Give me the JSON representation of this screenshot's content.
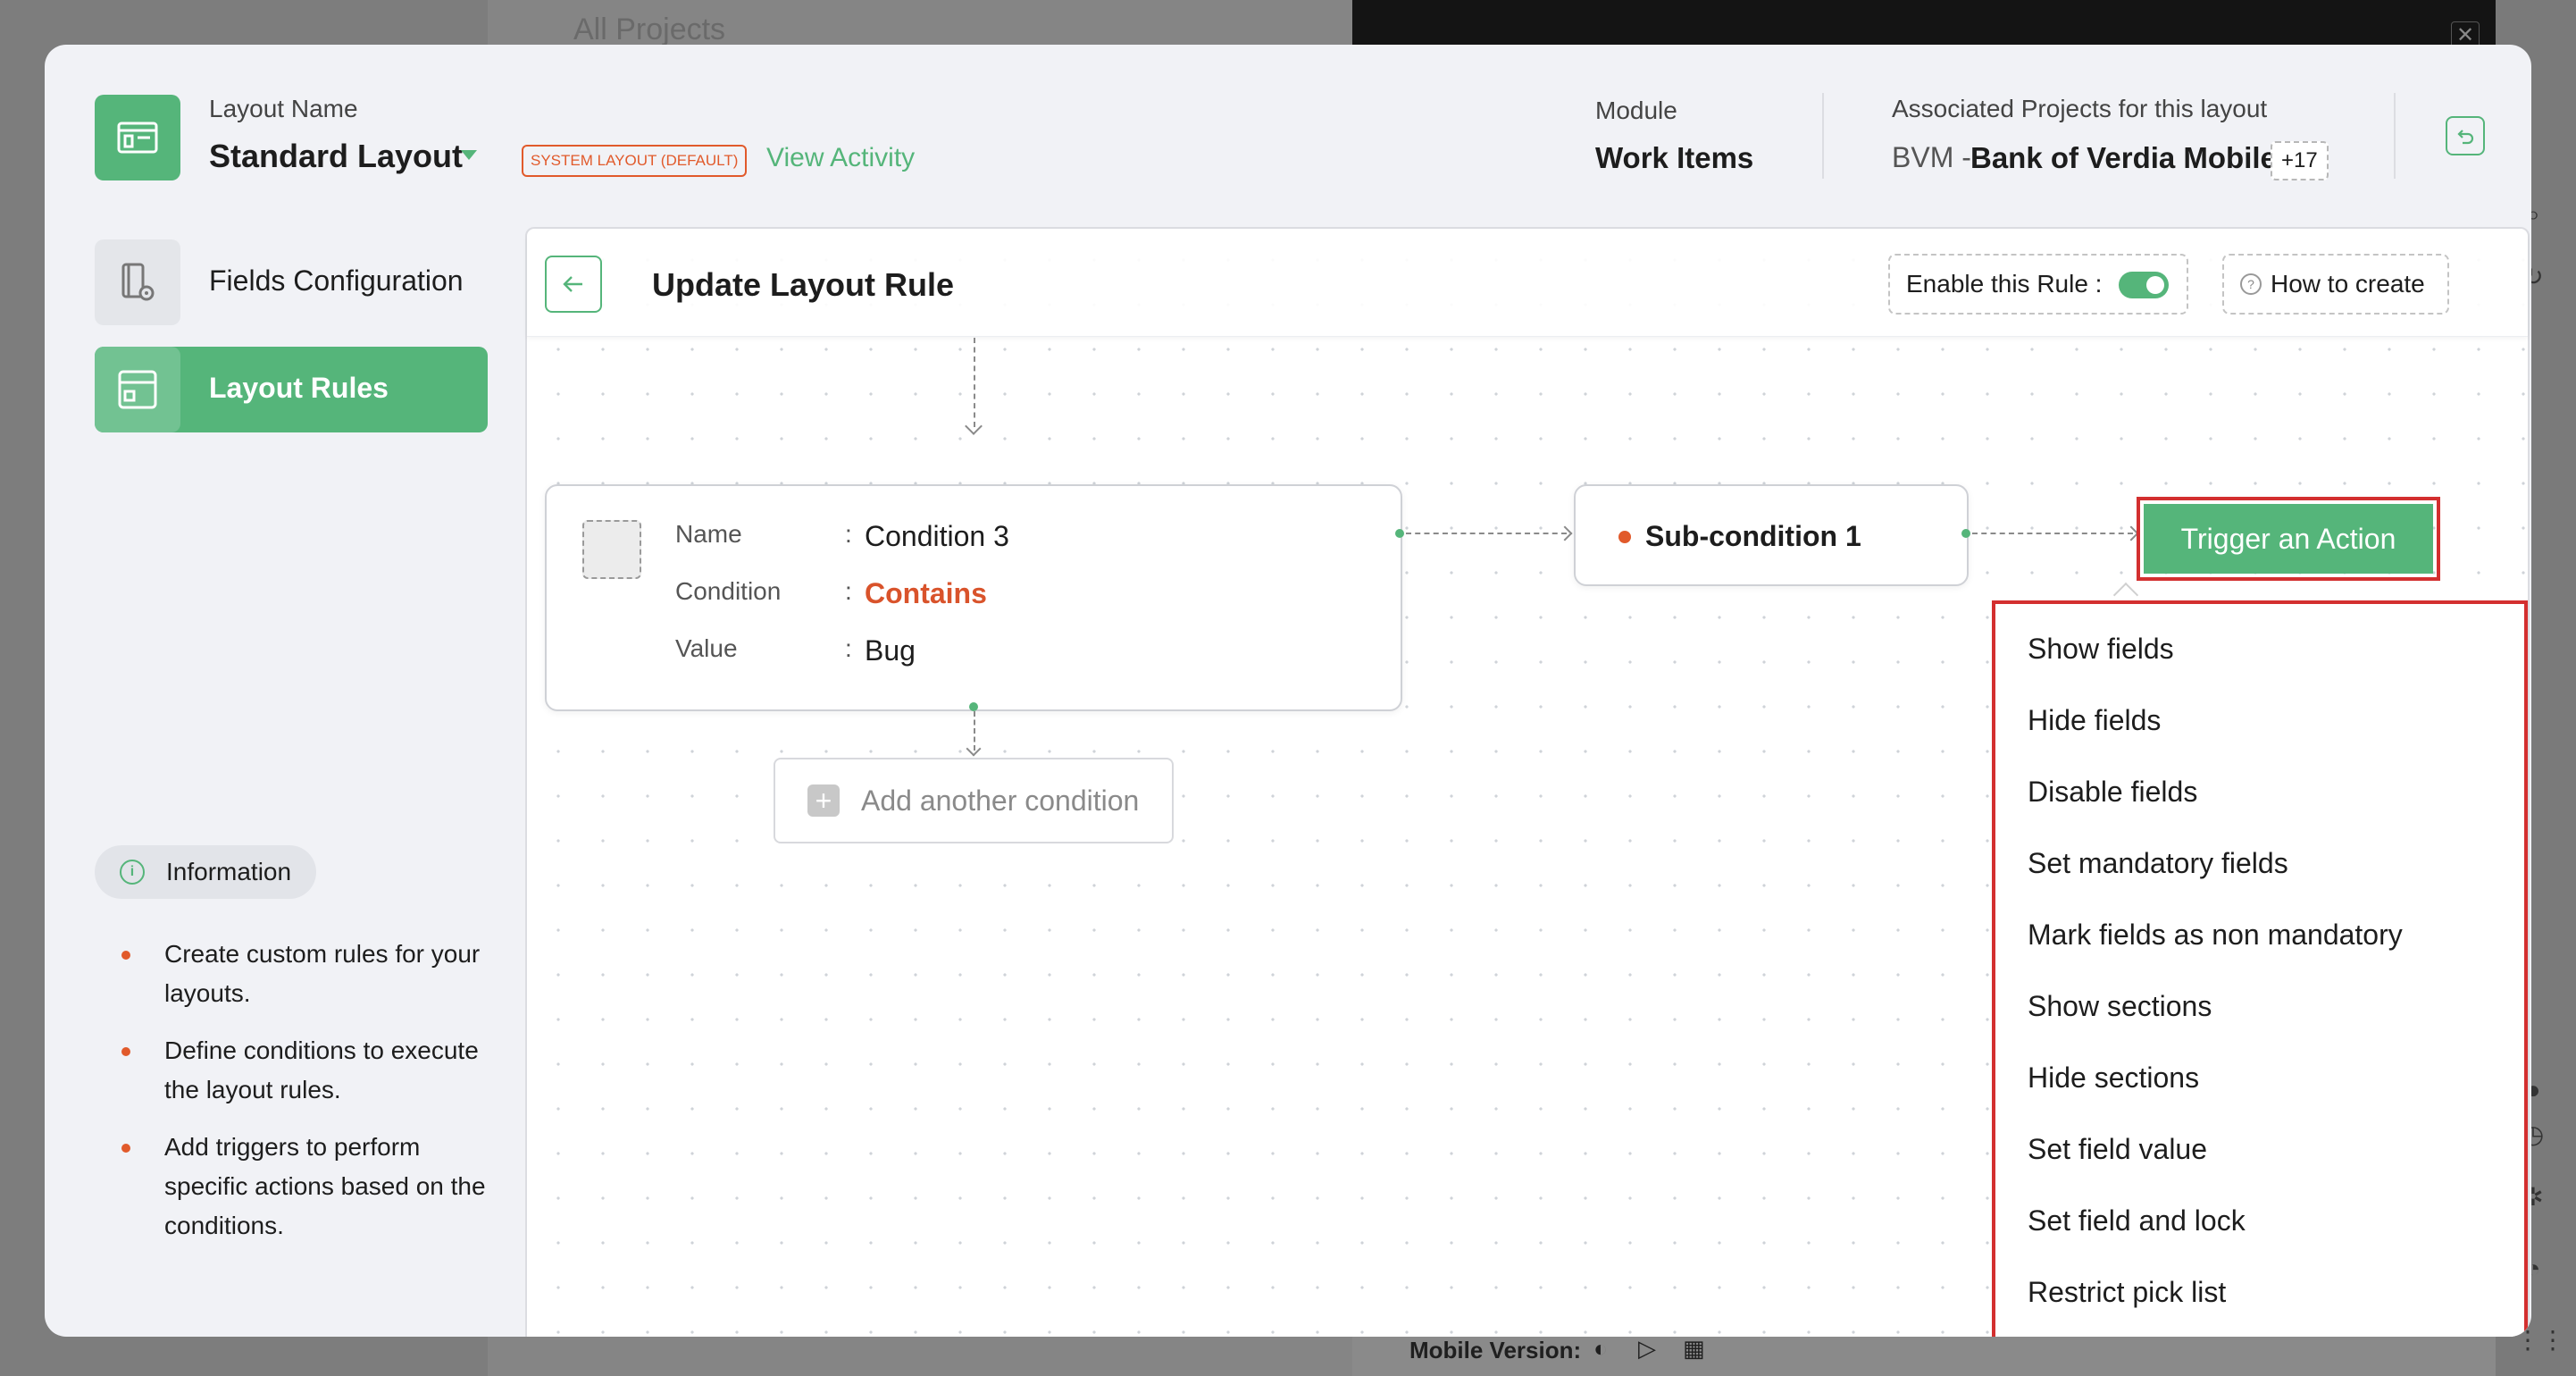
{
  "background": {
    "title": "All Projects",
    "mobile_version_label": "Mobile Version:",
    "close_label": "✕"
  },
  "header": {
    "layout_name_label": "Layout Name",
    "layout_name": "Standard Layout",
    "system_badge": "SYSTEM LAYOUT (DEFAULT)",
    "view_activity": "View Activity",
    "module_label": "Module",
    "module_value": "Work Items",
    "assoc_label": "Associated Projects for this layout",
    "assoc_prefix": "BVM -",
    "assoc_project": "Bank of Verdia Mobile",
    "assoc_more": "+17"
  },
  "sidebar": {
    "items": [
      {
        "label": "Fields Configuration"
      },
      {
        "label": "Layout Rules"
      }
    ],
    "info_label": "Information",
    "info_points": [
      "Create custom rules for your layouts.",
      "Define conditions to execute the layout rules.",
      "Add triggers to perform specific actions based on the conditions."
    ]
  },
  "canvas": {
    "title": "Update Layout Rule",
    "enable_label": "Enable this Rule :",
    "enable_state": "on",
    "how_to": "How to create",
    "condition": {
      "name_key": "Name",
      "name_value": "Condition 3",
      "condition_key": "Condition",
      "condition_value": "Contains",
      "value_key": "Value",
      "value_value": "Bug",
      "colon": ":"
    },
    "add_condition": "Add another condition",
    "sub_condition": "Sub-condition 1",
    "trigger": "Trigger an Action",
    "actions": [
      "Show fields",
      "Hide fields",
      "Disable fields",
      "Set mandatory fields",
      "Mark fields as non mandatory",
      "Show sections",
      "Hide sections",
      "Set field value",
      "Set field and lock",
      "Restrict pick list"
    ]
  },
  "colors": {
    "accent": "#55b57a",
    "warning": "#e15a2b",
    "highlight": "#d32f2f"
  }
}
